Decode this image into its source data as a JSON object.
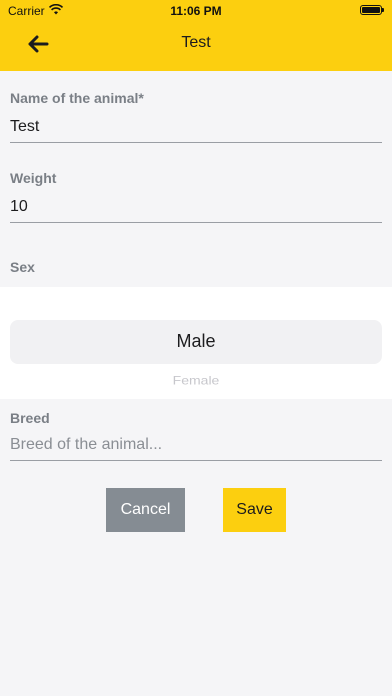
{
  "status_bar": {
    "carrier": "Carrier",
    "time": "11:06 PM",
    "wifi_icon": "wifi-icon",
    "battery_icon": "battery-icon"
  },
  "nav": {
    "title": "Test",
    "back_icon": "arrow-left-icon"
  },
  "form": {
    "name": {
      "label": "Name of the animal*",
      "value": "Test",
      "placeholder": ""
    },
    "weight": {
      "label": "Weight",
      "value": "10",
      "placeholder": ""
    },
    "sex": {
      "label": "Sex",
      "selected": "Male",
      "next_option": "Female"
    },
    "breed": {
      "label": "Breed",
      "value": "",
      "placeholder": "Breed of the animal..."
    }
  },
  "actions": {
    "cancel_label": "Cancel",
    "save_label": "Save"
  },
  "colors": {
    "accent": "#fccf0f",
    "cancel": "#858c93",
    "background": "#f5f5f7",
    "label": "#7a7f86"
  }
}
